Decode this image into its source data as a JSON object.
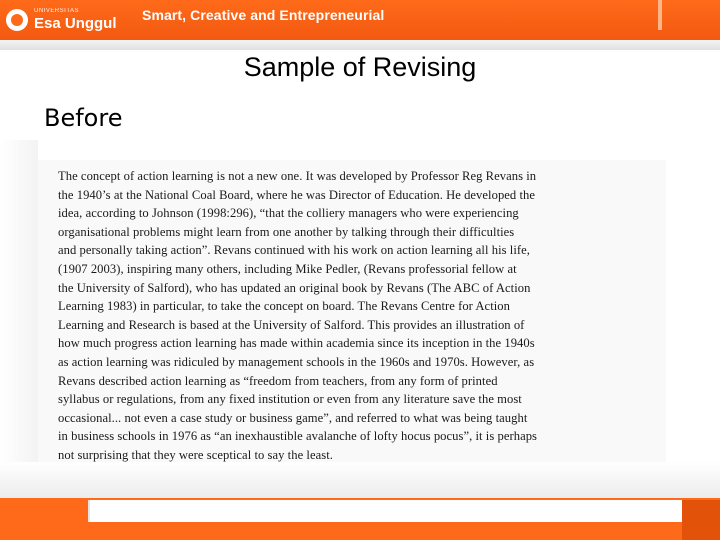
{
  "header": {
    "logo_sub": "UNIVERSITAS",
    "logo_name": "Esa Unggul",
    "tagline": "Smart, Creative and Entrepreneurial"
  },
  "title": "Sample of Revising",
  "section_label": "Before",
  "scanned_text": {
    "lines": [
      "The concept of action learning is not a new one. It was developed by Professor Reg Revans in",
      "the 1940’s at the National Coal Board, where he was Director of Education. He developed the",
      "idea, according to Johnson (1998:296), “that the colliery managers who were experiencing",
      "organisational problems might learn from one another by talking through their difficulties",
      "and personally taking action”. Revans continued with his work on action learning all his life,",
      "(1907   2003),  inspiring many others, including Mike Pedler, (Revans professorial fellow at",
      "the University of Salford), who has updated an original book by Revans (The ABC of Action",
      "Learning 1983) in particular, to take the concept on board. The Revans Centre for Action",
      "Learning and Research is based at the University of Salford. This provides an illustration of",
      "how much progress action learning has made within academia since its inception in the 1940s",
      "as action learning was ridiculed by management schools in the 1960s and 1970s. However, as",
      "Revans described action learning as “freedom from teachers, from any form of printed",
      "syllabus or regulations, from any fixed institution or even from any literature save the most",
      "occasional... not even a case study or business game”, and referred to what was being taught",
      "in business schools in 1976 as “an inexhaustible avalanche of lofty hocus pocus”, it is perhaps",
      "not surprising that they were sceptical to say the least."
    ]
  }
}
